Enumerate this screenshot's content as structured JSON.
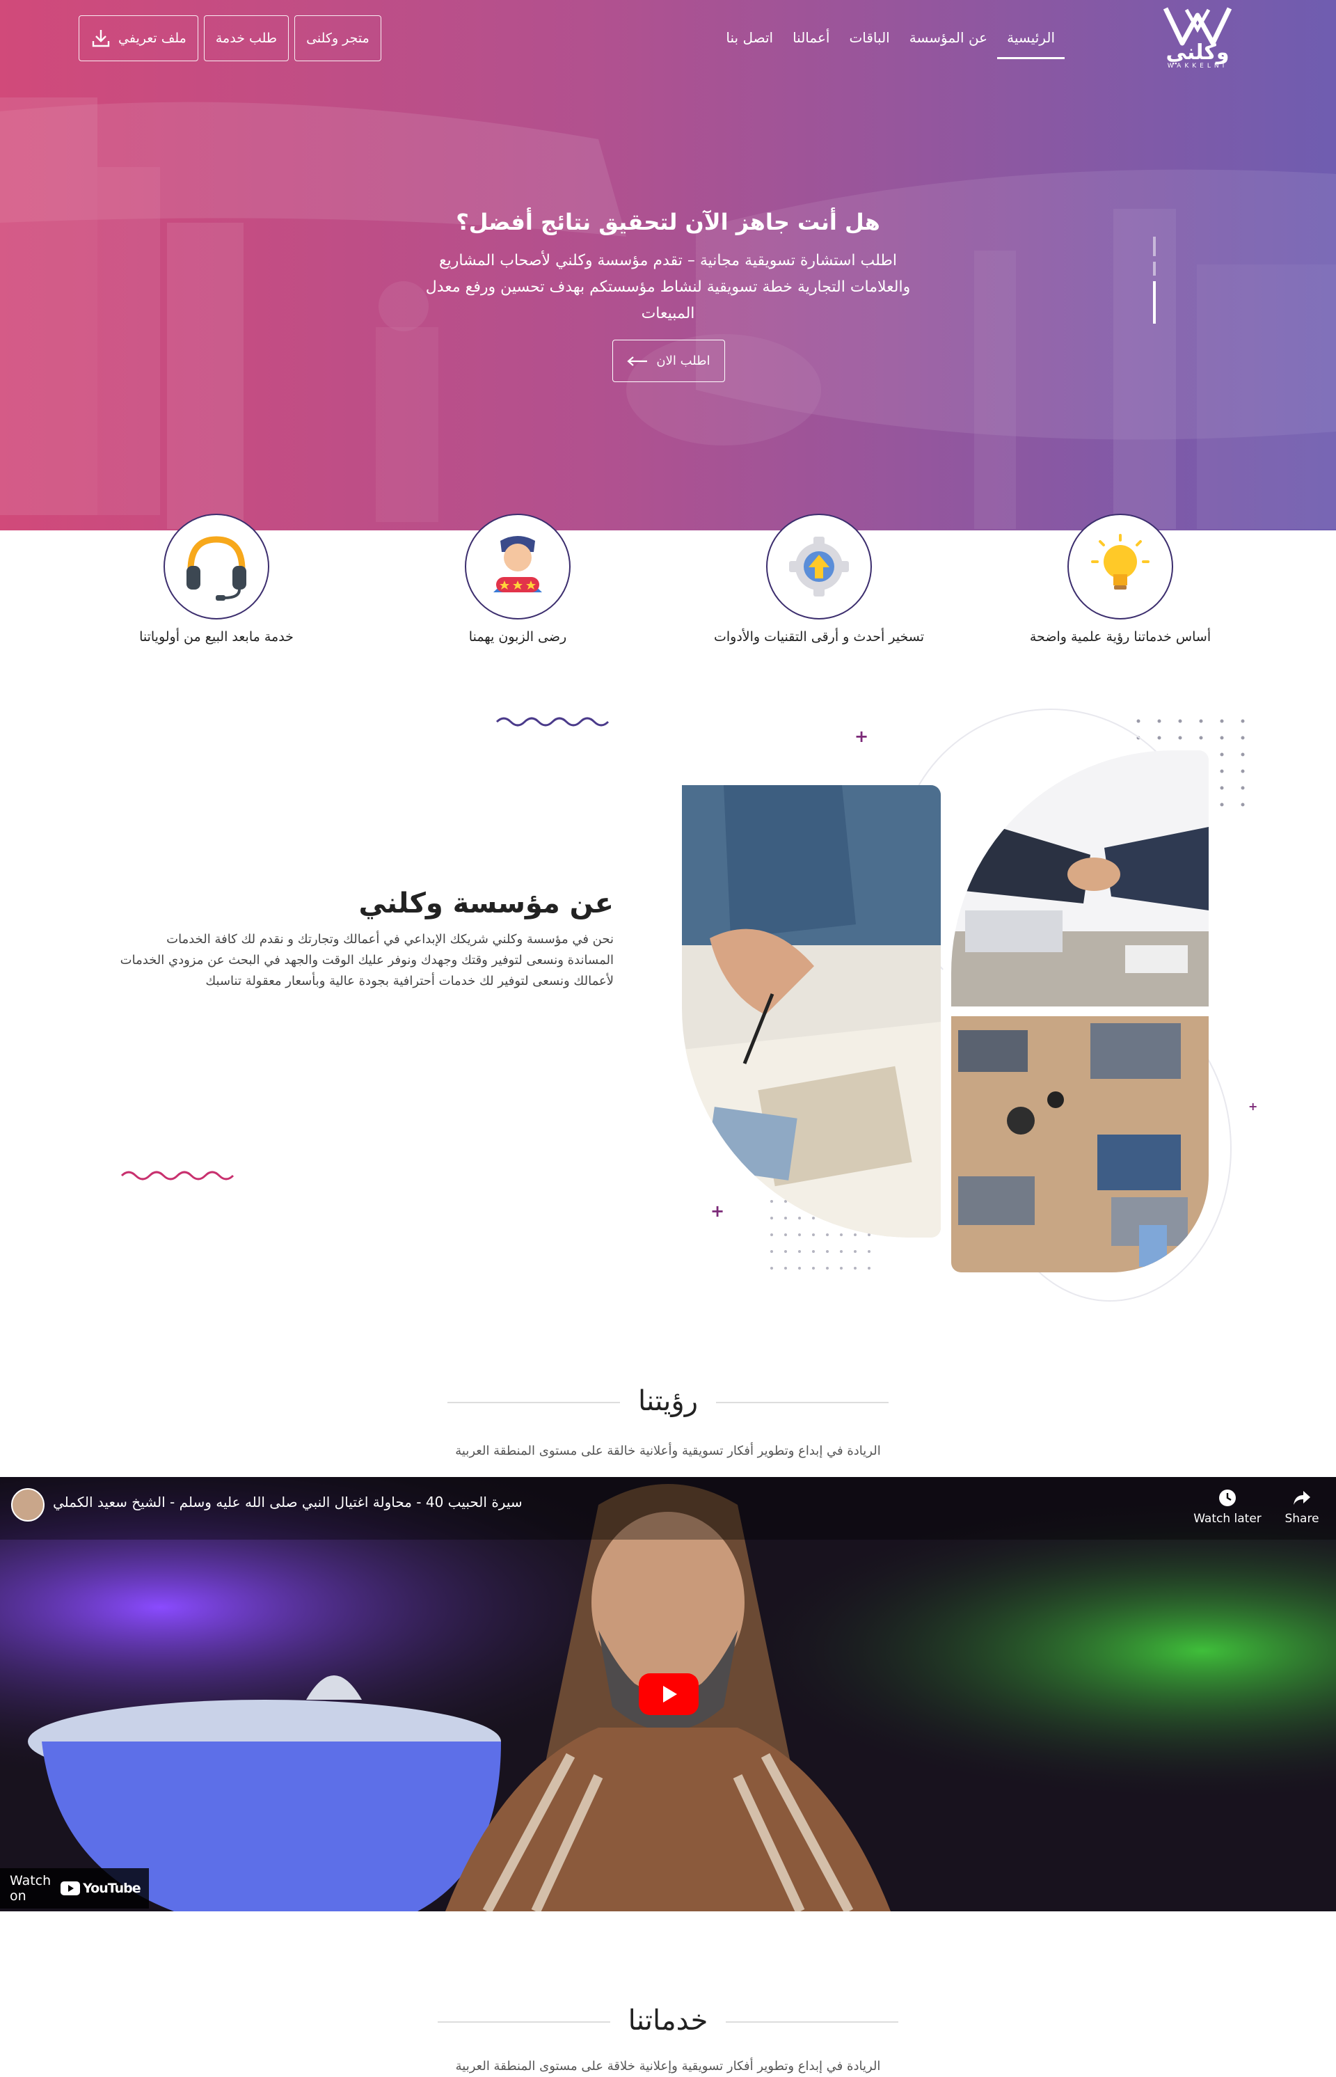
{
  "brand": {
    "name": "وكلني",
    "latin": "WAKKELNI"
  },
  "nav": {
    "items": [
      "الرئيسية",
      "عن المؤسسة",
      "الباقات",
      "أعمالنا",
      "اتصل بنا"
    ],
    "active_index": 0
  },
  "top_buttons": {
    "profile": "ملف تعريفي",
    "request_service": "طلب خدمة",
    "agents_store": "متجر وكلنى"
  },
  "hero": {
    "title": "هل أنت جاهز الآن لتحقيق نتائج أفضل؟",
    "description": "اطلب استشارة تسويقية مجانية – تقدم مؤسسة وكلني لأصحاب المشاريع والعلامات التجارية خطة تسويقية لنشاط مؤسستكم بهدف تحسين ورفع معدل المبيعات",
    "cta": "اطلب الان"
  },
  "features": [
    {
      "label": "أساس خدماتنا رؤية علمية واضحة",
      "icon": "lightbulb-icon"
    },
    {
      "label": "تسخير أحدث و أرقى التقنيات والأدوات",
      "icon": "gear-upgrade-icon"
    },
    {
      "label": "رضى الزبون يهمنا",
      "icon": "customer-rating-icon"
    },
    {
      "label": "خدمة مابعد البيع من أولوياتنا",
      "icon": "headset-icon"
    }
  ],
  "about": {
    "title": "عن مؤسسة وكلني",
    "text": "نحن في مؤسسة وكلني شريكك الإبداعي في أعمالك وتجارتك و نقدم لك كافة الخدمات المساندة ونسعى لتوفير وقتك وجهدك ونوفر عليك الوقت والجهد في البحث عن مزودي الخدمات لأعمالك ونسعى لتوفير لك خدمات أحترافية بجودة عالية وبأسعار معقولة تناسبك"
  },
  "vision": {
    "title": "رؤيتنا",
    "subtitle": "الريادة في إبداع وتطوير أفكار تسويقية وأعلانية خالقة على مستوى المنطقة العربية"
  },
  "video": {
    "title": "سيرة الحبيب 40 - محاولة اغتيال النبي صلى الله عليه وسلم - الشيخ سعيد الكملي",
    "watch_later": "Watch later",
    "share": "Share",
    "watch_on": "Watch on",
    "platform": "YouTube"
  },
  "services": {
    "title": "خدماتنا",
    "subtitle": "الريادة في إبداع وتطوير أفكار تسويقية وإعلانية خلاقة على مستوى المنطقة العربية"
  },
  "colors": {
    "hero_start": "#d14a7a",
    "hero_end": "#6f5db0",
    "accent": "#7c2a78",
    "circle_border": "#3c2e6e"
  }
}
